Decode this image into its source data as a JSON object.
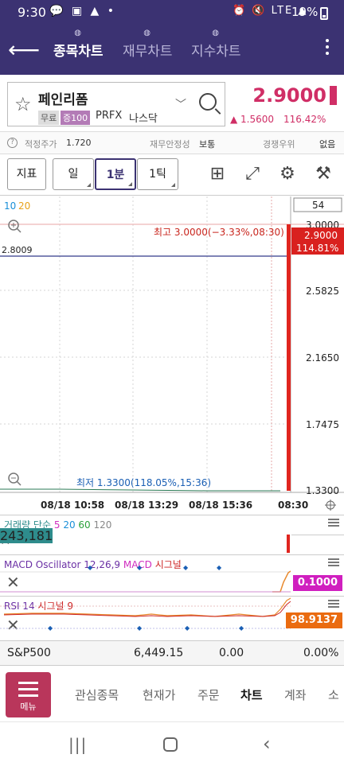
{
  "status_bar": {
    "time": "9:30",
    "notif_icons": "💬 ▣ ▲ •",
    "right_icons": "⏰ 🔇 LTE ▲",
    "battery": "19%"
  },
  "nav": {
    "tabs": [
      "종목차트",
      "재무차트",
      "지수차트"
    ],
    "active_tab": "종목차트"
  },
  "stock": {
    "name": "페인리폼",
    "tag_free": "무료",
    "tag_margin": "증100",
    "code": "PRFX",
    "exchange": "나스닥",
    "price": "2.9000",
    "change": "▲ 1.5600",
    "change_pct": "116.42%"
  },
  "info": {
    "fair_price_label": "적정주가",
    "fair_price_value": "1.720",
    "stability_label": "재무안정성",
    "stability_value": "보통",
    "rank_label": "경쟁우위",
    "rank_value": "없음"
  },
  "toolbar": {
    "indicator": "지표",
    "period": "일",
    "interval": "1분",
    "tick": "1틱",
    "icons": [
      "grid-icon",
      "expand-icon",
      "settings-icon",
      "tools-icon"
    ]
  },
  "chart": {
    "ma_labels": [
      "10",
      "20"
    ],
    "count": "54",
    "top_label": "3.0000",
    "high_label": "최고 3.0000(−3.33%,08:30)",
    "low_label": "최저 1.3300(118.05%,15:36)",
    "last_price": "2.9000",
    "last_pct": "114.81%",
    "ref_line": "2.8009",
    "y_ticks": [
      "2.5825",
      "2.1650",
      "1.7475",
      "1.3300"
    ],
    "x_ticks": [
      "08/18 10:58",
      "08/18 13:29",
      "08/18 15:36",
      "08:30"
    ]
  },
  "chart_data": {
    "type": "line",
    "title": "",
    "ylim": [
      1.33,
      3.0
    ],
    "x": [
      "08/18 10:58",
      "08/18 13:29",
      "08/18 15:36",
      "08:30"
    ],
    "series": [
      {
        "name": "",
        "values": [
          1.34,
          1.335,
          1.33,
          2.9
        ]
      }
    ],
    "high": 3.0,
    "low": 1.33,
    "last": 2.9
  },
  "volume": {
    "label_prefix": "거래량 단순",
    "ma": [
      "5",
      "20",
      "60",
      "120"
    ],
    "value": "243,181"
  },
  "macd": {
    "label": "MACD Oscillator 12,26,9",
    "label2": "MACD",
    "label3": "시그널",
    "value": "0.1000"
  },
  "rsi": {
    "label": "RSI 14",
    "label2": "시그널 9",
    "value": "98.9137"
  },
  "sp500": {
    "name": "S&P500",
    "value": "6,449.15",
    "change": "0.00",
    "pct": "0.00%"
  },
  "bottom_menu": {
    "menu_label": "메뉴",
    "items": [
      "관심종목",
      "현재가",
      "주문",
      "차트",
      "계좌",
      "소"
    ],
    "active": "차트"
  },
  "colors": {
    "brand": "#3b3272",
    "up": "#d02e66",
    "bar_red": "#e0251f",
    "macd_badge": "#d01fbf",
    "rsi_badge": "#ea6b10",
    "vol_badge": "#2e8c8c"
  }
}
